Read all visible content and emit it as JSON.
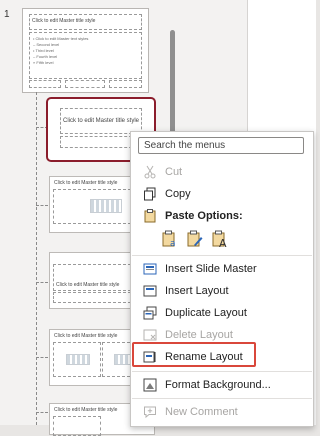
{
  "thumbnails": {
    "slide_number": "1",
    "master_title": "Click to edit Master title style",
    "master_text_lines": [
      "• Click to edit Master text styles",
      "  – Second level",
      "    • Third level",
      "      – Fourth level",
      "        » Fifth level"
    ],
    "layout_title": "Click to edit Master title style"
  },
  "context_menu": {
    "search_placeholder": "Search the menus",
    "cut": "Cut",
    "copy": "Copy",
    "paste_options": "Paste Options:",
    "insert_slide_master": "Insert Slide Master",
    "insert_layout": "Insert Layout",
    "duplicate_layout": "Duplicate Layout",
    "delete_layout": "Delete Layout",
    "rename_layout": "Rename Layout",
    "format_background": "Format Background...",
    "new_comment": "New Comment"
  },
  "colors": {
    "selection_border": "#8b1d2c",
    "highlight_box": "#d9473b",
    "accent_blue": "#2b66b8"
  }
}
